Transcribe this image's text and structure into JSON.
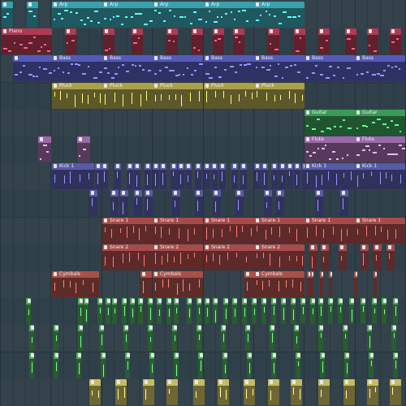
{
  "playlist": {
    "colors": {
      "background": "#34434b",
      "arp": "#3aa0ad",
      "piano": "#b03a52",
      "bass": "#5559b8",
      "pluck": "#a9a04a",
      "guitar": "#3a9a58",
      "flute": "#9a6aa8",
      "kick": "#585aa8",
      "snare": "#a94a4a",
      "cymbals": "#a9504a",
      "perc": "#4aa858",
      "hat": "#c8bb60"
    },
    "clip_icon": "pattern-icon",
    "labels": {
      "arp": "Arp",
      "piano": "Piano",
      "bass": "Bass",
      "pluck": "Pluck",
      "guitar": "Guitar",
      "flute": "Flute",
      "kick": "Kick 1",
      "snare1": "Snare 1",
      "snare2": "Snare 2",
      "cymbals": "Cymbals"
    }
  }
}
